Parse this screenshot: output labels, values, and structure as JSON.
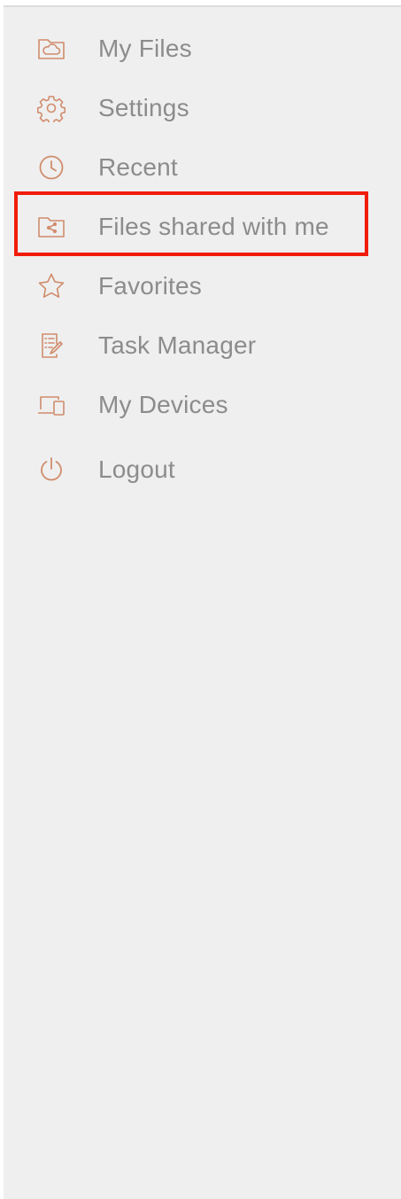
{
  "colors": {
    "icon": "#d08c6c",
    "label": "#8c8c8c",
    "panel_bg": "#efefef",
    "highlight": "#f11d0a"
  },
  "menu": {
    "items": [
      {
        "label": "My Files",
        "icon": "cloud-folder-icon"
      },
      {
        "label": "Settings",
        "icon": "gear-icon"
      },
      {
        "label": "Recent",
        "icon": "clock-icon"
      },
      {
        "label": "Files shared with me",
        "icon": "shared-folder-icon"
      },
      {
        "label": "Favorites",
        "icon": "star-icon"
      },
      {
        "label": "Task Manager",
        "icon": "task-list-icon"
      },
      {
        "label": "My Devices",
        "icon": "devices-icon"
      },
      {
        "label": "Logout",
        "icon": "power-icon"
      }
    ]
  }
}
